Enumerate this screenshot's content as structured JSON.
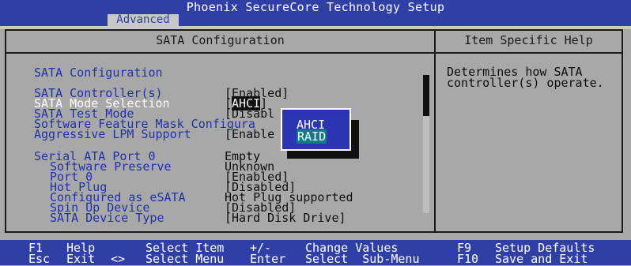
{
  "app": {
    "title": "Phoenix SecureCore Technology Setup",
    "active_tab": "Advanced"
  },
  "panel": {
    "heading": "SATA Configuration",
    "help_heading": "Item Specific Help",
    "help_text_line1": "Determines how SATA",
    "help_text_line2": "controller(s) operate."
  },
  "settings": {
    "section1_title": "SATA Configuration",
    "items": [
      {
        "label": "SATA Controller(s)",
        "value": "[Enabled]"
      },
      {
        "label": "SATA Mode Selection",
        "value_prefix": "[",
        "value": "AHCI",
        "value_suffix": "]"
      },
      {
        "label": "SATA Test Mode",
        "value": "[Disabl"
      },
      {
        "label": "Software Feature Mask Configura",
        "value": ""
      },
      {
        "label": "Aggressive LPM Support",
        "value": "[Enable"
      }
    ],
    "port": {
      "label": "Serial ATA Port 0",
      "value": "Empty",
      "subitems": [
        {
          "label": "Software Preserve",
          "value": "Unknown"
        },
        {
          "label": "Port 0",
          "value": "[Enabled]"
        },
        {
          "label": "Hot Plug",
          "value": "[Disabled]"
        },
        {
          "label": "Configured as eSATA",
          "value": "Hot Plug supported"
        },
        {
          "label": "Spin Up Device",
          "value": "[Disabled]"
        },
        {
          "label": "SATA Device Type",
          "value": "[Hard Disk Drive]"
        }
      ]
    }
  },
  "popup": {
    "options": [
      "AHCI",
      "RAID"
    ],
    "highlighted": "RAID"
  },
  "footer": {
    "row1": [
      {
        "key": "F1",
        "label": "Help"
      },
      {
        "key": "",
        "label": "Select Item"
      },
      {
        "key": "+/-",
        "label": "Change Values"
      },
      {
        "key": "F9",
        "label": "Setup Defaults"
      }
    ],
    "row2": [
      {
        "key": "Esc",
        "label": "Exit"
      },
      {
        "key": "<>",
        "label": "Select Menu"
      },
      {
        "key": "Enter",
        "label": "Select  Sub-Menu"
      },
      {
        "key": "F10",
        "label": "Save and Exit"
      }
    ]
  },
  "colors": {
    "bios_blue": "#2f3fa6",
    "panel_gray": "#a8a8a8",
    "item_blue": "#1f32a8",
    "highlight_teal": "#0c7c86"
  }
}
